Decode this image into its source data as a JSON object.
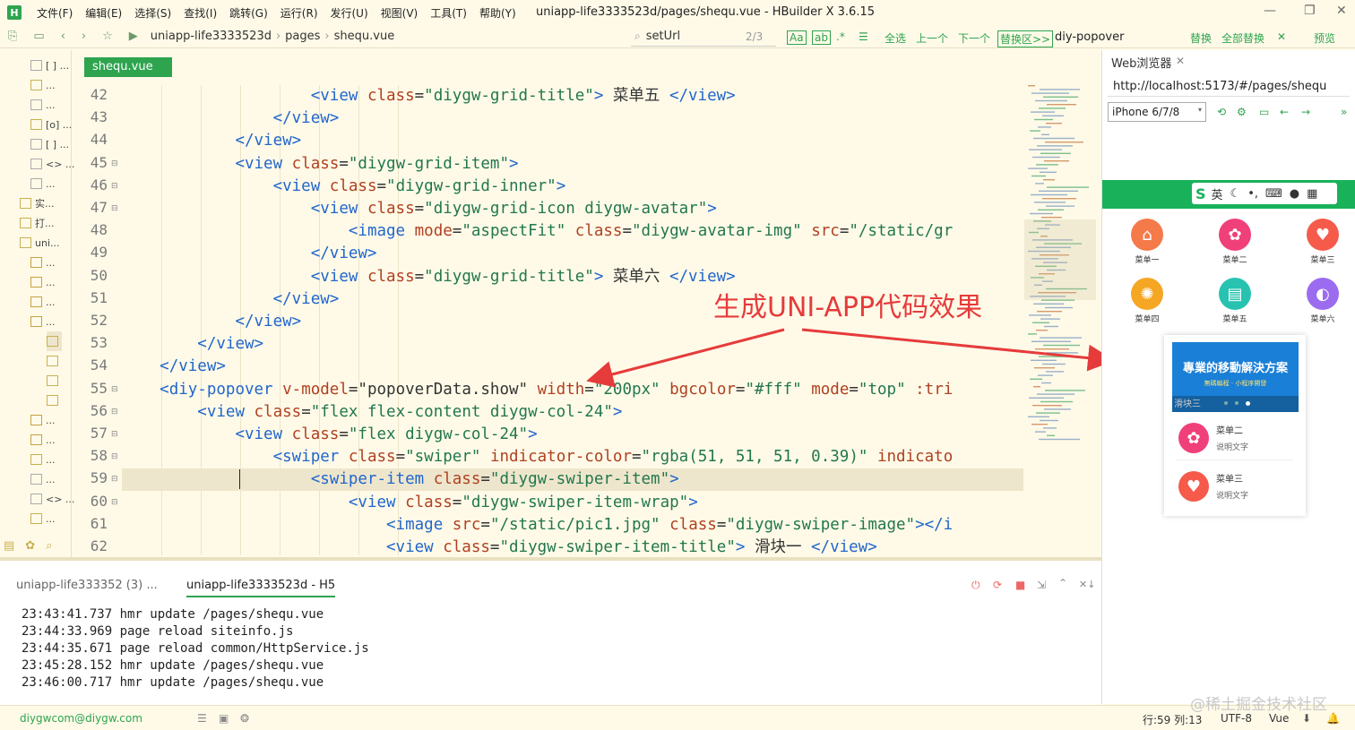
{
  "menubar": {
    "items": [
      "文件(F)",
      "编辑(E)",
      "选择(S)",
      "查找(I)",
      "跳转(G)",
      "运行(R)",
      "发行(U)",
      "视图(V)",
      "工具(T)",
      "帮助(Y)"
    ],
    "title": "uniapp-life3333523d/pages/shequ.vue - HBuilder X 3.6.15"
  },
  "toolbar": {
    "breadcrumb": [
      "uniapp-life3333523d",
      "pages",
      "shequ.vue"
    ],
    "search_value": "setUrl",
    "match_count": "2/3",
    "case_label": "Aa",
    "word_label": "ab",
    "select_all": "全选",
    "prev": "上一个",
    "next": "下一个",
    "replace_area": "替换区>>",
    "replace_value": "diy-popover",
    "replace": "替换",
    "replace_all": "全部替换",
    "preview": "预览"
  },
  "sidebar": {
    "items": [
      "[ ] ...",
      "...",
      "...",
      "[o] ...",
      "[ ] ...",
      "<> ...",
      "...",
      "实...",
      "打...",
      "uni...",
      "...",
      "...",
      "...",
      "...",
      "",
      "",
      "",
      "",
      "...",
      "...",
      "...",
      "...",
      "<> ...",
      "..."
    ]
  },
  "editor": {
    "tab": "shequ.vue",
    "lines": [
      {
        "n": "42",
        "fold": "",
        "parts": [
          [
            "",
            "                    "
          ],
          [
            "tag",
            "<view "
          ],
          [
            "attr",
            "class"
          ],
          [
            "txt",
            "="
          ],
          [
            "str",
            "\"diygw-grid-title\""
          ],
          [
            "tag",
            "> "
          ],
          [
            "txt",
            "菜单五 "
          ],
          [
            "tag",
            "</view>"
          ]
        ]
      },
      {
        "n": "43",
        "fold": "",
        "parts": [
          [
            "",
            "                "
          ],
          [
            "tag",
            "</view>"
          ]
        ]
      },
      {
        "n": "44",
        "fold": "",
        "parts": [
          [
            "",
            "            "
          ],
          [
            "tag",
            "</view>"
          ]
        ]
      },
      {
        "n": "45",
        "fold": "⊟",
        "parts": [
          [
            "",
            "            "
          ],
          [
            "tag",
            "<view "
          ],
          [
            "attr",
            "class"
          ],
          [
            "txt",
            "="
          ],
          [
            "str",
            "\"diygw-grid-item\""
          ],
          [
            "tag",
            ">"
          ]
        ]
      },
      {
        "n": "46",
        "fold": "⊟",
        "parts": [
          [
            "",
            "                "
          ],
          [
            "tag",
            "<view "
          ],
          [
            "attr",
            "class"
          ],
          [
            "txt",
            "="
          ],
          [
            "str",
            "\"diygw-grid-inner\""
          ],
          [
            "tag",
            ">"
          ]
        ]
      },
      {
        "n": "47",
        "fold": "⊟",
        "parts": [
          [
            "",
            "                    "
          ],
          [
            "tag",
            "<view "
          ],
          [
            "attr",
            "class"
          ],
          [
            "txt",
            "="
          ],
          [
            "str",
            "\"diygw-grid-icon diygw-avatar\""
          ],
          [
            "tag",
            ">"
          ]
        ]
      },
      {
        "n": "48",
        "fold": "",
        "parts": [
          [
            "",
            "                        "
          ],
          [
            "tag",
            "<image "
          ],
          [
            "attr",
            "mode"
          ],
          [
            "txt",
            "="
          ],
          [
            "str",
            "\"aspectFit\" "
          ],
          [
            "attr",
            "class"
          ],
          [
            "txt",
            "="
          ],
          [
            "str",
            "\"diygw-avatar-img\" "
          ],
          [
            "attr",
            "src"
          ],
          [
            "txt",
            "="
          ],
          [
            "str",
            "\"/static/gr"
          ]
        ]
      },
      {
        "n": "49",
        "fold": "",
        "parts": [
          [
            "",
            "                    "
          ],
          [
            "tag",
            "</view>"
          ]
        ]
      },
      {
        "n": "50",
        "fold": "",
        "parts": [
          [
            "",
            "                    "
          ],
          [
            "tag",
            "<view "
          ],
          [
            "attr",
            "class"
          ],
          [
            "txt",
            "="
          ],
          [
            "str",
            "\"diygw-grid-title\""
          ],
          [
            "tag",
            "> "
          ],
          [
            "txt",
            "菜单六 "
          ],
          [
            "tag",
            "</view>"
          ]
        ]
      },
      {
        "n": "51",
        "fold": "",
        "parts": [
          [
            "",
            "                "
          ],
          [
            "tag",
            "</view>"
          ]
        ]
      },
      {
        "n": "52",
        "fold": "",
        "parts": [
          [
            "",
            "            "
          ],
          [
            "tag",
            "</view>"
          ]
        ]
      },
      {
        "n": "53",
        "fold": "",
        "parts": [
          [
            "",
            "        "
          ],
          [
            "tag",
            "</view>"
          ]
        ]
      },
      {
        "n": "54",
        "fold": "",
        "parts": [
          [
            "",
            "    "
          ],
          [
            "tag",
            "</view>"
          ]
        ]
      },
      {
        "n": "55",
        "fold": "⊟",
        "parts": [
          [
            "",
            "    "
          ],
          [
            "tag",
            "<diy-popover "
          ],
          [
            "attr",
            "v-model"
          ],
          [
            "txt",
            "=\"popoverData.show\" "
          ],
          [
            "attr",
            "width"
          ],
          [
            "txt",
            "="
          ],
          [
            "str",
            "\"200px\" "
          ],
          [
            "attr",
            "bgcolor"
          ],
          [
            "txt",
            "="
          ],
          [
            "str",
            "\"#fff\" "
          ],
          [
            "attr",
            "mode"
          ],
          [
            "txt",
            "="
          ],
          [
            "str",
            "\"top\" "
          ],
          [
            "attr",
            ":tri"
          ]
        ]
      },
      {
        "n": "56",
        "fold": "⊟",
        "parts": [
          [
            "",
            "        "
          ],
          [
            "tag",
            "<view "
          ],
          [
            "attr",
            "class"
          ],
          [
            "txt",
            "="
          ],
          [
            "str",
            "\"flex flex-content diygw-col-24\""
          ],
          [
            "tag",
            ">"
          ]
        ]
      },
      {
        "n": "57",
        "fold": "⊟",
        "parts": [
          [
            "",
            "            "
          ],
          [
            "tag",
            "<view "
          ],
          [
            "attr",
            "class"
          ],
          [
            "txt",
            "="
          ],
          [
            "str",
            "\"flex diygw-col-24\""
          ],
          [
            "tag",
            ">"
          ]
        ]
      },
      {
        "n": "58",
        "fold": "⊟",
        "parts": [
          [
            "",
            "                "
          ],
          [
            "tag",
            "<swiper "
          ],
          [
            "attr",
            "class"
          ],
          [
            "txt",
            "="
          ],
          [
            "str",
            "\"swiper\" "
          ],
          [
            "attr",
            "indicator-color"
          ],
          [
            "txt",
            "="
          ],
          [
            "str",
            "\"rgba(51, 51, 51, 0.39)\" "
          ],
          [
            "attr",
            "indicato"
          ]
        ]
      },
      {
        "n": "59",
        "fold": "⊟",
        "parts": [
          [
            "",
            "                    "
          ],
          [
            "tag",
            "<swiper-item "
          ],
          [
            "attr",
            "class"
          ],
          [
            "txt",
            "="
          ],
          [
            "str",
            "\"diygw-swiper-item\""
          ],
          [
            "tag",
            ">"
          ]
        ]
      },
      {
        "n": "60",
        "fold": "⊟",
        "parts": [
          [
            "",
            "                        "
          ],
          [
            "tag",
            "<view "
          ],
          [
            "attr",
            "class"
          ],
          [
            "txt",
            "="
          ],
          [
            "str",
            "\"diygw-swiper-item-wrap\""
          ],
          [
            "tag",
            ">"
          ]
        ]
      },
      {
        "n": "61",
        "fold": "",
        "parts": [
          [
            "",
            "                            "
          ],
          [
            "tag",
            "<image "
          ],
          [
            "attr",
            "src"
          ],
          [
            "txt",
            "="
          ],
          [
            "str",
            "\"/static/pic1.jpg\" "
          ],
          [
            "attr",
            "class"
          ],
          [
            "txt",
            "="
          ],
          [
            "str",
            "\"diygw-swiper-image\""
          ],
          [
            "tag",
            "></i"
          ]
        ]
      },
      {
        "n": "62",
        "fold": "",
        "parts": [
          [
            "",
            "                            "
          ],
          [
            "tag",
            "<view "
          ],
          [
            "attr",
            "class"
          ],
          [
            "txt",
            "="
          ],
          [
            "str",
            "\"diygw-swiper-item-title\""
          ],
          [
            "tag",
            "> "
          ],
          [
            "txt",
            "滑块一 "
          ],
          [
            "tag",
            "</view>"
          ]
        ]
      }
    ],
    "highlight_line": "59"
  },
  "annotation": {
    "text": "生成UNI-APP代码效果"
  },
  "preview": {
    "tab": "Web浏览器",
    "url": "http://localhost:5173/#/pages/shequ",
    "device": "iPhone 6/7/8",
    "ime": "英",
    "grid": [
      {
        "label": "菜单一",
        "color": "#f57a4a",
        "icon": "⌂"
      },
      {
        "label": "菜单二",
        "color": "#f0407a",
        "icon": "✿"
      },
      {
        "label": "菜单三",
        "color": "#f55a4a",
        "icon": "♥"
      },
      {
        "label": "菜单四",
        "color": "#f5a623",
        "icon": "✺"
      },
      {
        "label": "菜单五",
        "color": "#28c3b0",
        "icon": "▤"
      },
      {
        "label": "菜单六",
        "color": "#9b6cf0",
        "icon": "◐"
      }
    ],
    "popover": {
      "swiper_title": "專業的移動解決方案",
      "swiper_sub": "無碼編程 · 小程序開發",
      "swiper_label": "滑块三",
      "items": [
        {
          "title": "菜单二",
          "desc": "说明文字",
          "color": "#f0407a",
          "icon": "✿"
        },
        {
          "title": "菜单三",
          "desc": "说明文字",
          "color": "#f55a4a",
          "icon": "♥"
        }
      ]
    }
  },
  "console": {
    "tabs": [
      "uniapp-life333352 (3) ...",
      "uniapp-life3333523d - H5"
    ],
    "logs": [
      "23:43:41.737 hmr update /pages/shequ.vue",
      "23:44:33.969 page reload siteinfo.js",
      "23:44:35.671 page reload common/HttpService.js",
      "23:45:28.152 hmr update /pages/shequ.vue",
      "23:46:00.717 hmr update /pages/shequ.vue"
    ]
  },
  "status": {
    "user": "diygwcom@diygw.com",
    "position": "行:59  列:13",
    "encoding": "UTF-8",
    "lang": "Vue",
    "watermark": "@稀土掘金技术社区"
  },
  "colors": {
    "accent": "#2ea44f",
    "annotation": "#e63b3b"
  }
}
